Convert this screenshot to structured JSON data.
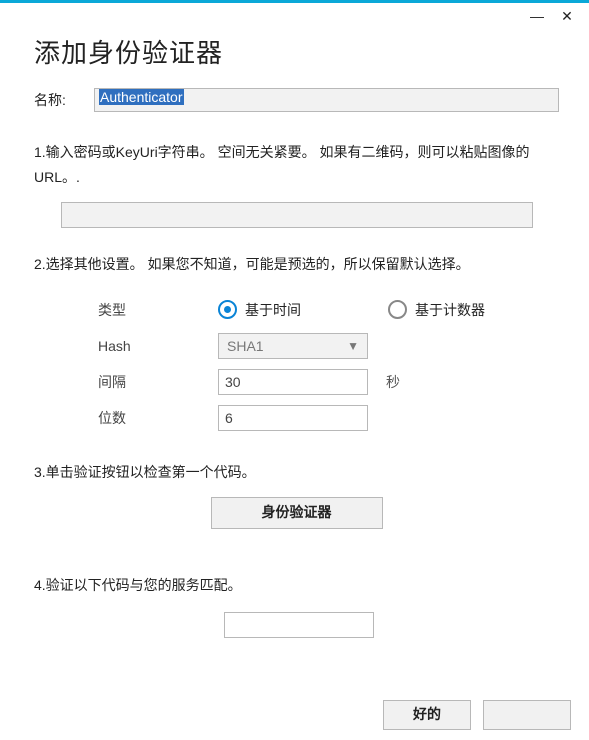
{
  "window": {
    "title": "添加身份验证器",
    "name_label": "名称:",
    "name_value": "Authenticator"
  },
  "steps": {
    "s1": "1.输入密码或KeyUri字符串。 空间无关紧要。 如果有二维码，则可以粘贴图像的URL。.",
    "s2": "2.选择其他设置。 如果您不知道，可能是预选的，所以保留默认选择。",
    "s3": "3.单击验证按钮以检查第一个代码。",
    "s4": "4.验证以下代码与您的服务匹配。"
  },
  "settings": {
    "type_label": "类型",
    "radio_time": "基于时间",
    "radio_counter": "基于计数器",
    "hash_label": "Hash",
    "hash_value": "SHA1",
    "interval_label": "间隔",
    "interval_value": "30",
    "interval_unit": "秒",
    "digits_label": "位数",
    "digits_value": "6"
  },
  "buttons": {
    "verify": "身份验证器",
    "ok": "好的",
    "cancel": ""
  }
}
